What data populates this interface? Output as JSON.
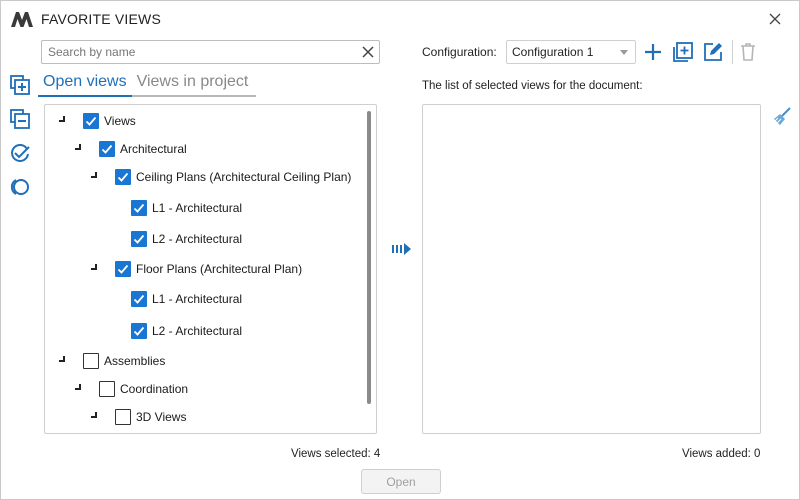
{
  "window": {
    "title": "FAVORITE VIEWS",
    "icon": "app-logo-icon",
    "close_icon": "close-icon"
  },
  "search": {
    "placeholder": "Search by name",
    "value": "",
    "clear_icon": "clear-icon"
  },
  "tools": [
    {
      "name": "add-views-icon"
    },
    {
      "name": "remove-views-icon"
    },
    {
      "name": "check-all-icon"
    },
    {
      "name": "clear-selection-icon"
    }
  ],
  "tabs": [
    {
      "label": "Open views",
      "active": true
    },
    {
      "label": "Views in project",
      "active": false
    }
  ],
  "tree": [
    {
      "label": "Views",
      "level": 0,
      "checked": true
    },
    {
      "label": "Architectural",
      "level": 1,
      "checked": true
    },
    {
      "label": "Ceiling Plans (Architectural Ceiling Plan)",
      "level": 2,
      "checked": true
    },
    {
      "label": "L1 - Architectural",
      "level": 3,
      "checked": true
    },
    {
      "label": "L2 - Architectural",
      "level": 3,
      "checked": true
    },
    {
      "label": "Floor Plans (Architectural Plan)",
      "level": 2,
      "checked": true
    },
    {
      "label": "L1 - Architectural",
      "level": 3,
      "checked": true
    },
    {
      "label": "L2 - Architectural",
      "level": 3,
      "checked": true
    },
    {
      "label": "Assemblies",
      "level": 0,
      "checked": false
    },
    {
      "label": "Coordination",
      "level": 1,
      "checked": false
    },
    {
      "label": "3D Views",
      "level": 2,
      "checked": false
    }
  ],
  "move_icon": "move-right-icon",
  "config": {
    "label": "Configuration:",
    "selected": "Configuration 1",
    "actions": [
      "add-icon",
      "add-copy-icon",
      "edit-icon",
      "delete-icon"
    ]
  },
  "selected_list": {
    "label": "The list of selected views for the document:",
    "items": [],
    "clear_icon": "broom-icon"
  },
  "status": {
    "views_selected": "Views selected: 4",
    "views_added": "Views added: 0"
  },
  "footer": {
    "open_label": "Open"
  },
  "colors": {
    "accent": "#1976d2",
    "tab_active": "#1f6fb9",
    "disabled_text": "#a0a0a0"
  }
}
